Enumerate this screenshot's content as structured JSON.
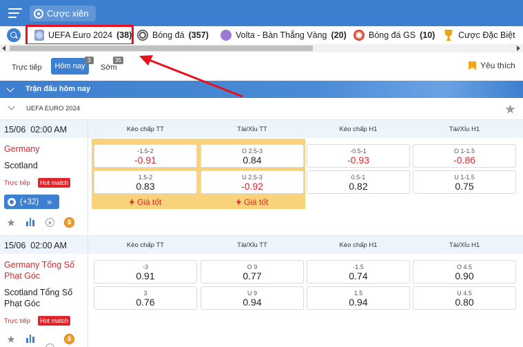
{
  "header": {
    "title": "Cược xiên"
  },
  "leagues": [
    {
      "name": "UEFA Euro 2024",
      "count": "(38)"
    },
    {
      "name": "Bóng đá",
      "count": "(357)"
    },
    {
      "name": "Volta - Bàn Thắng Vàng",
      "count": "(20)"
    },
    {
      "name": "Bóng đá GS",
      "count": "(10)"
    },
    {
      "name": "Cược Đặc Biệt",
      "count": ""
    }
  ],
  "tabs": [
    {
      "label": "Trực tiếp",
      "badge": ""
    },
    {
      "label": "Hôm nay",
      "badge": "3"
    },
    {
      "label": "Sớm",
      "badge": "35"
    }
  ],
  "favorites_label": "Yêu thích",
  "section_title": "Trận đấu hôm nay",
  "league_group": "UEFA EURO 2024",
  "columns": [
    "Kèo chấp TT",
    "Tài/Xỉu TT",
    "Kèo chấp H1",
    "Tài/Xỉu H1"
  ],
  "matches": [
    {
      "date": "15/06",
      "time": "02:00 AM",
      "home": "Germany",
      "away": "Scotland",
      "live_label": "Trực tiếp",
      "hot_label": "Hot match",
      "more_label": "(+32)",
      "good_price_label": "Giá tốt",
      "odds": [
        [
          {
            "line": "-1.5-2",
            "value": "-0.91",
            "neg": true
          },
          {
            "line": "O 2.5-3",
            "value": "0.84",
            "neg": false
          },
          {
            "line": "-0.5-1",
            "value": "-0.93",
            "neg": true
          },
          {
            "line": "O 1-1.5",
            "value": "-0.86",
            "neg": true
          }
        ],
        [
          {
            "line": "1.5-2",
            "value": "0.83",
            "neg": false
          },
          {
            "line": "U 2.5-3",
            "value": "-0.92",
            "neg": true
          },
          {
            "line": "0.5-1",
            "value": "0.82",
            "neg": false
          },
          {
            "line": "U 1-1.5",
            "value": "0.75",
            "neg": false
          }
        ]
      ]
    },
    {
      "date": "15/06",
      "time": "02:00 AM",
      "home": "Germany Tổng Số Phạt Góc",
      "away": "Scotland Tổng Số Phạt Góc",
      "live_label": "Trực tiếp",
      "hot_label": "Hot match",
      "odds": [
        [
          {
            "line": "-3",
            "value": "0.91",
            "neg": false
          },
          {
            "line": "O 9",
            "value": "0.77",
            "neg": false
          },
          {
            "line": "-1.5",
            "value": "0.74",
            "neg": false
          },
          {
            "line": "O 4.5",
            "value": "0.90",
            "neg": false
          }
        ],
        [
          {
            "line": "3",
            "value": "0.76",
            "neg": false
          },
          {
            "line": "U 9",
            "value": "0.94",
            "neg": false
          },
          {
            "line": "1.5",
            "value": "0.94",
            "neg": false
          },
          {
            "line": "U 4.5",
            "value": "0.80",
            "neg": false
          }
        ]
      ]
    }
  ],
  "icons": {
    "menu": "menu-icon",
    "parlay": "parlay-icon",
    "search": "search-icon",
    "favorite": "bookmark-icon",
    "collapse": "chevron-down-icon",
    "star": "star-icon",
    "stats": "stats-icon",
    "play": "play-icon",
    "cashout": "coin-icon",
    "bolt": "bolt-icon",
    "ball": "ball-icon"
  },
  "colors": {
    "primary": "#3d7fd0",
    "red": "#e0252a",
    "highlight": "#f8d37a",
    "annotation": "#e8101a"
  }
}
